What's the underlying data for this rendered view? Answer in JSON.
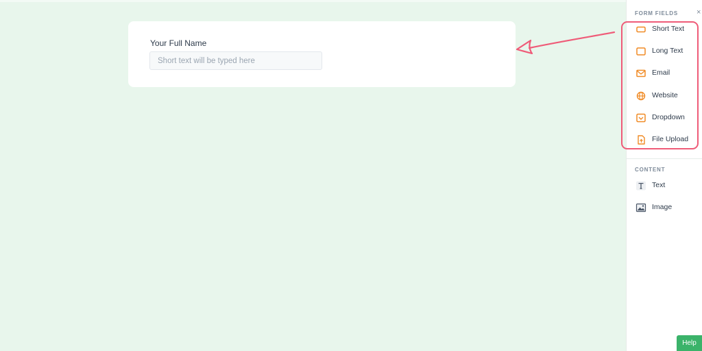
{
  "form": {
    "field_label": "Your Full Name",
    "field_placeholder": "Short text will be typed here"
  },
  "sidebar": {
    "form_fields_title": "FORM FIELDS",
    "close_glyph": "×",
    "form_fields": [
      {
        "label": "Short Text",
        "icon": "short-text-icon"
      },
      {
        "label": "Long Text",
        "icon": "long-text-icon"
      },
      {
        "label": "Email",
        "icon": "email-icon"
      },
      {
        "label": "Website",
        "icon": "globe-icon"
      },
      {
        "label": "Dropdown",
        "icon": "dropdown-icon"
      },
      {
        "label": "File Upload",
        "icon": "file-upload-icon"
      }
    ],
    "content_title": "CONTENT",
    "content_items": [
      {
        "label": "Text",
        "icon": "text-icon"
      },
      {
        "label": "Image",
        "icon": "image-icon"
      }
    ]
  },
  "help_label": "Help",
  "colors": {
    "canvas_bg": "#e8f6ec",
    "field_icon": "#f08a24",
    "highlight": "#ef5b78",
    "help_bg": "#3bb36a"
  }
}
